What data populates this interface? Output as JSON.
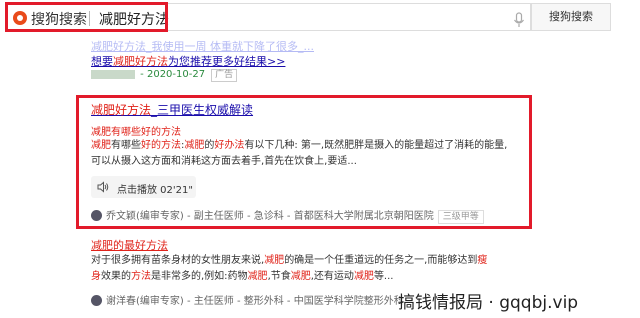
{
  "search": {
    "logo_text": "搜狗搜索",
    "query": "减肥好方法",
    "button_label": "搜狗搜索"
  },
  "result1": {
    "line1": "减肥好方法_我使用一周 体重就下降了很多_...",
    "line2_pre": "想要",
    "line2_em": "减肥好方法",
    "line2_post": "为您推荐更多好结果>>",
    "source_date": " - 2020-10-27",
    "ad_label": "广告"
  },
  "result2": {
    "title_em": "减肥好方法",
    "title_rest": "_三甲医生权威解读",
    "subtitle": "减肥有哪些好的方法",
    "text_line1_parts": [
      "减肥",
      "有哪些",
      "好的方法",
      ":",
      "减肥",
      "的",
      "好办法",
      "有以下几种: 第一,既然肥胖是摄入的能量超过了消耗的能量,"
    ],
    "text_line2": "可以从摄入这方面和消耗这方面去着手,首先在饮食上,要适...",
    "audio_label": "点击播放 02'21\"",
    "expert": "乔文颖(编审专家) - 副主任医师 - 急诊科 - 首都医科大学附属北京朝阳医院",
    "expert_grade": "三级甲等"
  },
  "result3": {
    "title": "减肥的最好方法",
    "text_line1_parts": [
      "对于很多拥有苗条身材的女性朋友来说,",
      "减肥",
      "的确是一个任重道远的任务之一,而能够达到",
      "瘦"
    ],
    "text_line2_parts": [
      "身",
      "效果的",
      "方法",
      "是非常多的,例如:药物",
      "减肥",
      ",节食",
      "减肥",
      ",还有运动",
      "减肥",
      "等..."
    ],
    "expert": "谢洋春(编审专家) - 主任医师 - 整形外科 - 中国医学科学院整形外科"
  },
  "watermark": {
    "text": "搞钱情报局 · gqqbj.vip"
  },
  "colors": {
    "highlight_red": "#e21a2a",
    "link_blue": "#1a0dab",
    "keyword_red": "#e0231a",
    "source_green": "#2a8a3e"
  },
  "icons": [
    "sogou-logo-icon",
    "microphone-icon",
    "speaker-icon",
    "avatar-icon"
  ]
}
